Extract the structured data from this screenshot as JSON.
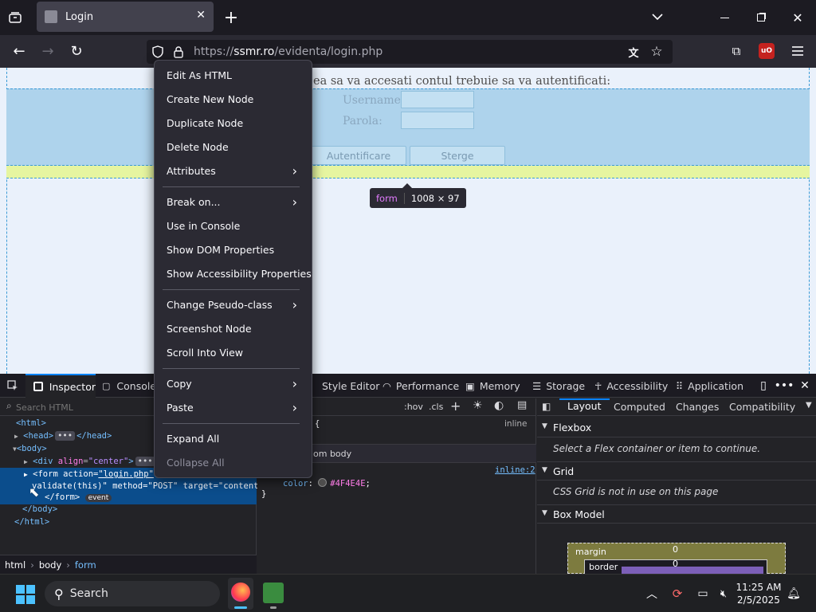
{
  "browser": {
    "tab_title": "Login",
    "url_prefix": "https://",
    "url_host": "ssmr.ro",
    "url_path": "/evidenta/login.php"
  },
  "page": {
    "intro": "Pentru a putea sa va accesati contul trebuie sa va autentificati:",
    "intro_visible": "ea sa va accesati contul trebuie sa va autentificati:",
    "username_label": "Username:",
    "password_label": "Parola:",
    "login_button": "Autentificare",
    "clear_button": "Sterge",
    "tooltip_tag": "form",
    "tooltip_size": "1008 × 97"
  },
  "context_menu": {
    "items": [
      {
        "label": "Edit As HTML"
      },
      {
        "label": "Create New Node"
      },
      {
        "label": "Duplicate Node"
      },
      {
        "label": "Delete Node"
      },
      {
        "label": "Attributes"
      },
      {
        "label": "Break on..."
      },
      {
        "label": "Use in Console"
      },
      {
        "label": "Show DOM Properties"
      },
      {
        "label": "Show Accessibility Properties"
      },
      {
        "label": "Change Pseudo-class"
      },
      {
        "label": "Screenshot Node"
      },
      {
        "label": "Scroll Into View"
      },
      {
        "label": "Copy"
      },
      {
        "label": "Paste"
      },
      {
        "label": "Expand All"
      },
      {
        "label": "Collapse All"
      }
    ]
  },
  "devtools": {
    "tabs": [
      "Inspector",
      "Console",
      "Style Editor",
      "Performance",
      "Memory",
      "Storage",
      "Accessibility",
      "Application"
    ],
    "search_placeholder": "Search HTML",
    "rules_hov": ":hov",
    "rules_cls": ".cls",
    "layout_tabs": [
      "Layout",
      "Computed",
      "Changes",
      "Compatibility"
    ],
    "flexbox_title": "Flexbox",
    "flexbox_msg": "Select a Flex container or item to continue.",
    "grid_title": "Grid",
    "grid_msg": "CSS Grid is not in use on this page",
    "boxmodel_title": "Box Model",
    "bm_margin": "margin",
    "bm_border": "border",
    "bm_margin_val": "0",
    "bm_border_val": "0",
    "rule_inline": "inline",
    "rule_from": "om body",
    "rule_link": "inline:2",
    "rule_prop": "color",
    "rule_value": "#4F4E4E",
    "rule_value_color": "#4F4E4E",
    "breadcrumb": [
      "html",
      "body",
      "form"
    ],
    "html_tree": {
      "l1": "<html>",
      "l2_tag": "<head>",
      "l2_end": "</head>",
      "l3": "<body>",
      "l4_tag": "<div",
      "l4_attr": "align",
      "l4_val": "\"center\"",
      "l4_end": "</",
      "l5_tag": "<form",
      "l5_attr": "action",
      "l5_val": "\"login.php\"",
      "l6": "validate(this)\" method=\"POST\" target=\"content\">",
      "l7": "</form>",
      "l7_badge": "event",
      "l8": "</body>",
      "l9": "</html>"
    }
  },
  "taskbar": {
    "search_label": "Search",
    "time": "11:25 AM",
    "date": "2/5/2025"
  },
  "colors": {
    "accent": "#0060df",
    "page_bg": "#eaf1fb",
    "highlight": "#e6f5a0"
  }
}
